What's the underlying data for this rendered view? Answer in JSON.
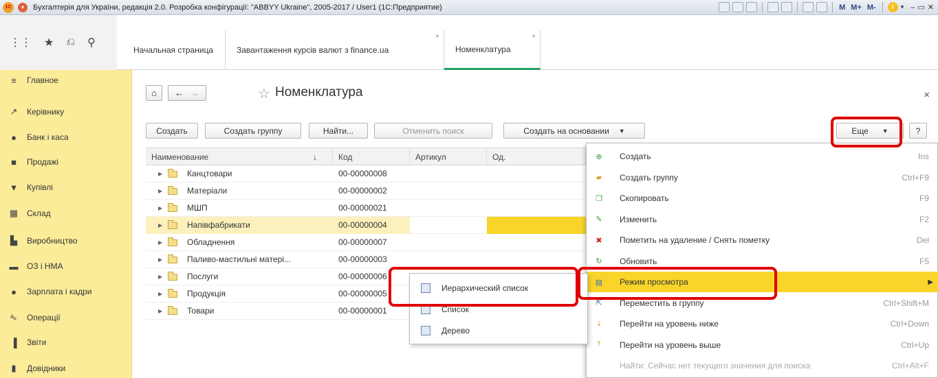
{
  "titlebar": {
    "title": "Бухгалтерія для України, редакція 2.0. Розробка конфігурації: \"ABBYY Ukraine\", 2005-2017 / User1  (1С:Предприятие)",
    "m_labels": [
      "M",
      "M+",
      "M-"
    ]
  },
  "tabs": [
    {
      "label": "Начальная страница"
    },
    {
      "label": "Завантаження курсів валют з finance.ua"
    },
    {
      "label": "Номенклатура"
    }
  ],
  "sidebar": {
    "items": [
      {
        "label": "Главное",
        "icon": "menu-icon"
      },
      {
        "label": "Керівнику",
        "icon": "chart-line-icon"
      },
      {
        "label": "Банк і каса",
        "icon": "bank-icon"
      },
      {
        "label": "Продажі",
        "icon": "bag-icon"
      },
      {
        "label": "Купівлі",
        "icon": "cart-icon"
      },
      {
        "label": "Склад",
        "icon": "warehouse-icon"
      },
      {
        "label": "Виробництво",
        "icon": "factory-icon"
      },
      {
        "label": "ОЗ і НМА",
        "icon": "truck-icon"
      },
      {
        "label": "Зарплата і кадри",
        "icon": "person-icon"
      },
      {
        "label": "Операції",
        "icon": "operations-icon"
      },
      {
        "label": "Звіти",
        "icon": "bar-chart-icon"
      },
      {
        "label": "Довідники",
        "icon": "book-icon"
      }
    ]
  },
  "page": {
    "title": "Номенклатура"
  },
  "toolbar": {
    "create": "Создать",
    "create_group": "Создать группу",
    "find": "Найти...",
    "cancel_search": "Отменить поиск",
    "create_based": "Создать на основании",
    "more": "Еще",
    "help": "?"
  },
  "table": {
    "columns": [
      "Наименование",
      "Код",
      "Артикул",
      "Од."
    ],
    "sort_indicator": "↓",
    "rows": [
      {
        "name": "Канцтовари",
        "code": "00-00000008",
        "selected": false
      },
      {
        "name": "Матеріали",
        "code": "00-00000002",
        "selected": false
      },
      {
        "name": "МШП",
        "code": "00-00000021",
        "selected": false
      },
      {
        "name": "Напівфабрикати",
        "code": "00-00000004",
        "selected": true
      },
      {
        "name": "Обладнення",
        "code": "00-00000007",
        "selected": false
      },
      {
        "name": "Паливо-мастильні матері...",
        "code": "00-00000003",
        "selected": false
      },
      {
        "name": "Послуги",
        "code": "00-00000006",
        "selected": false
      },
      {
        "name": "Продукція",
        "code": "00-00000005",
        "selected": false
      },
      {
        "name": "Товари",
        "code": "00-00000001",
        "selected": false
      }
    ]
  },
  "context_menu": {
    "items": [
      {
        "label": "Создать",
        "key": "Ins",
        "icon": "plus-circle-icon",
        "color": "#3aa040"
      },
      {
        "label": "Создать группу",
        "key": "Ctrl+F9",
        "icon": "folder-add-icon",
        "color": "#d8a020"
      },
      {
        "label": "Скопировать",
        "key": "F9",
        "icon": "copy-icon",
        "color": "#3aa040"
      },
      {
        "label": "Изменить",
        "key": "F2",
        "icon": "pencil-icon",
        "color": "#3aa040"
      },
      {
        "label": "Пометить на удаление / Снять пометку",
        "key": "Del",
        "icon": "delete-mark-icon",
        "color": "#d02020"
      },
      {
        "label": "Обновить",
        "key": "F5",
        "icon": "refresh-icon",
        "color": "#3aa040"
      },
      {
        "label": "Режим просмотра",
        "key": "",
        "icon": "view-mode-icon",
        "color": "#4070b0",
        "highlight": true,
        "submenu": true
      },
      {
        "label": "Переместить в группу",
        "key": "Ctrl+Shift+M",
        "icon": "move-icon",
        "color": "#4070b0"
      },
      {
        "label": "Перейти на уровень ниже",
        "key": "Ctrl+Down",
        "icon": "level-down-icon",
        "color": "#d8a020"
      },
      {
        "label": "Перейти на уровень выше",
        "key": "Ctrl+Up",
        "icon": "level-up-icon",
        "color": "#d8a020"
      },
      {
        "label": "Найти: Сейчас нет текущего значения для поиска",
        "key": "Ctrl+Alt+F",
        "icon": "",
        "disabled": true
      }
    ]
  },
  "view_submenu": {
    "items": [
      {
        "label": "Иерархический список",
        "icon": "hierarchical-list-icon"
      },
      {
        "label": "Список",
        "icon": "list-icon"
      },
      {
        "label": "Дерево",
        "icon": "tree-icon"
      }
    ]
  }
}
